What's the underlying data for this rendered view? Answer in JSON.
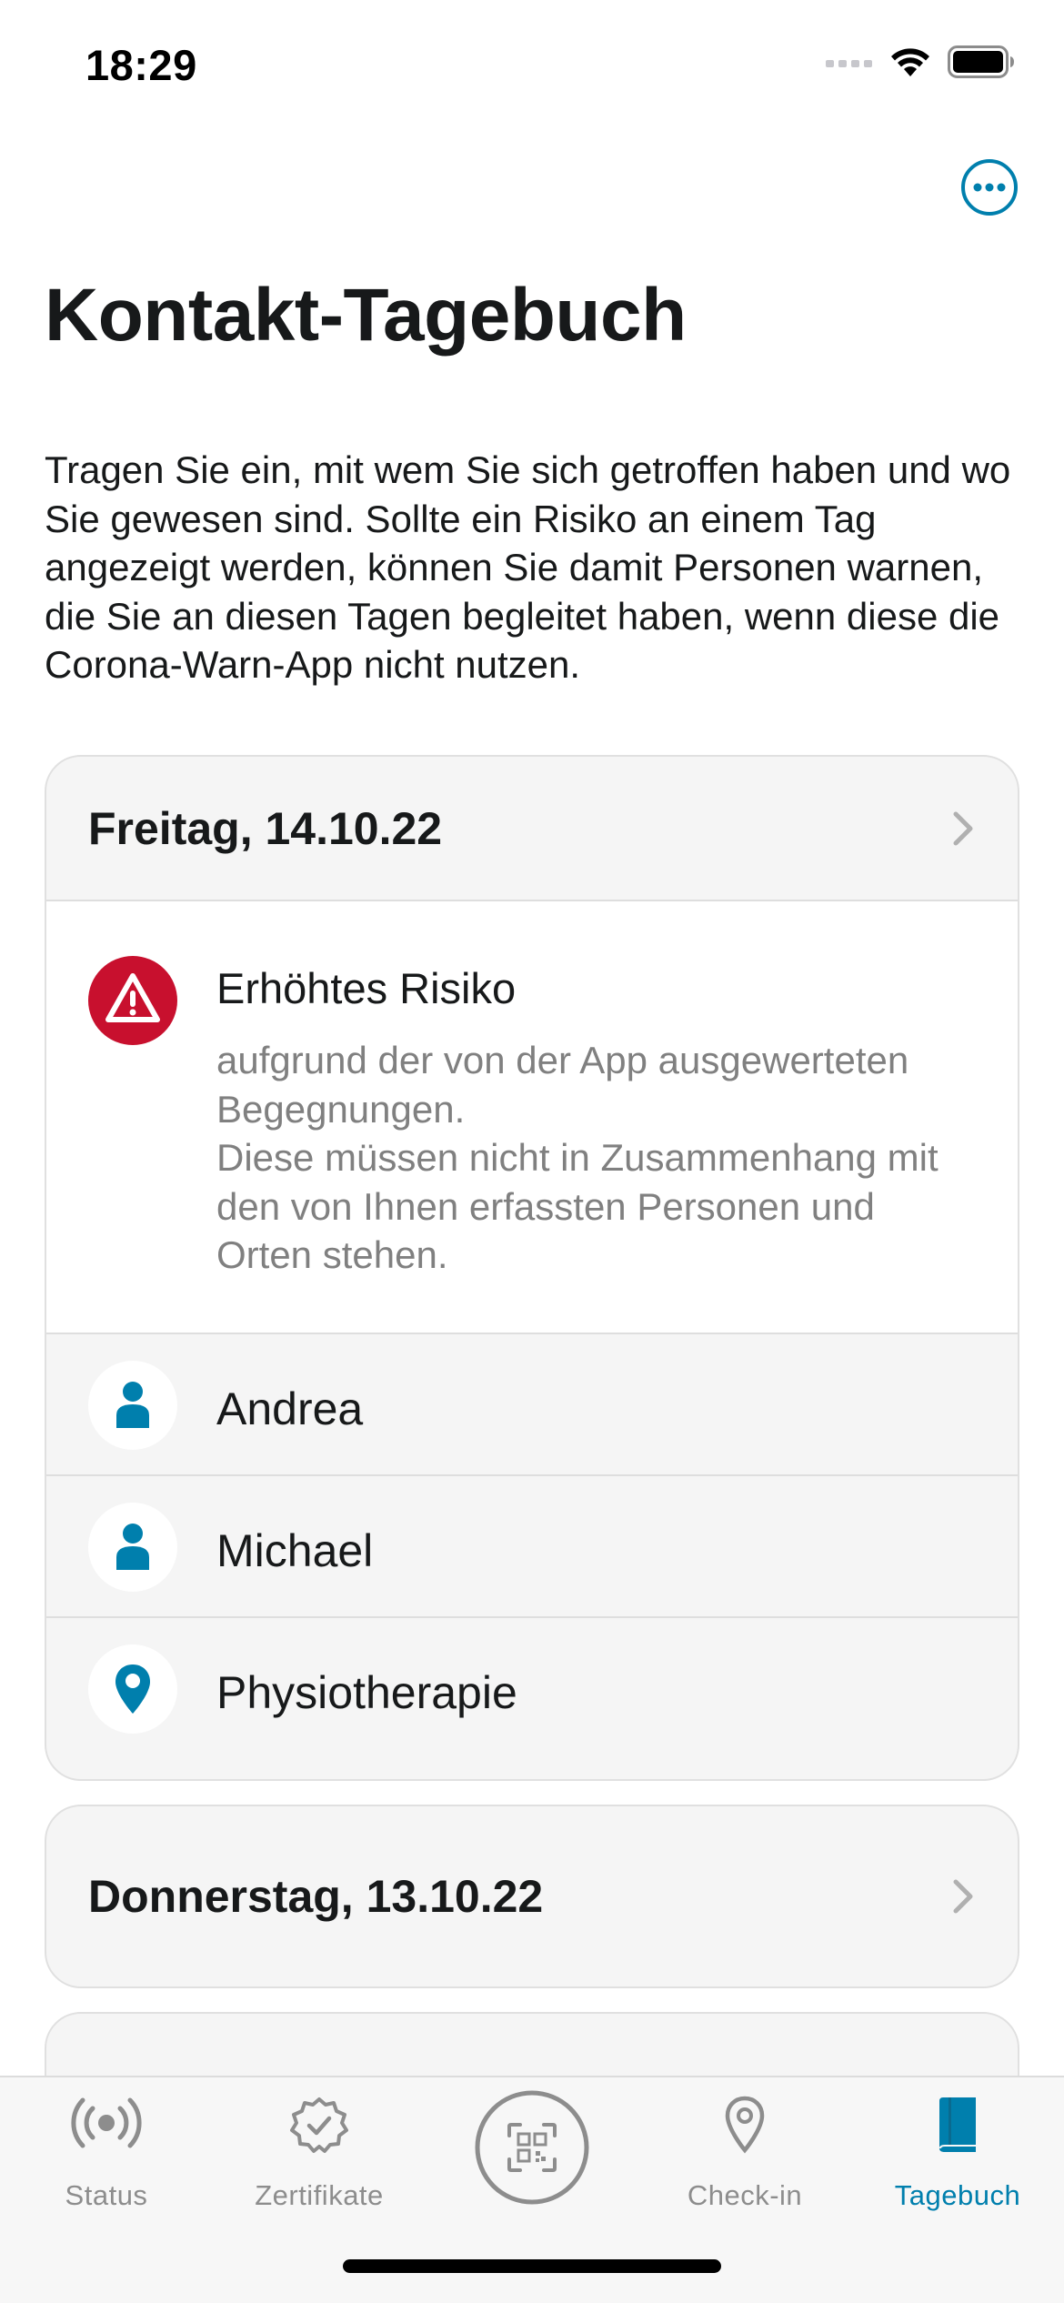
{
  "status_bar": {
    "time": "18:29"
  },
  "page": {
    "title": "Kontakt-Tagebuch",
    "intro": "Tragen Sie ein, mit wem Sie sich getroffen haben und wo Sie gewesen sind. Sollte ein Risiko an einem Tag angezeigt werden, können Sie damit Personen warnen, die Sie an diesen Tagen begleitet haben, wenn diese die Corona-Warn-App nicht nutzen."
  },
  "days": [
    {
      "date": "Freitag, 14.10.22",
      "risk": {
        "title": "Erhöhtes Risiko",
        "description": "aufgrund der von der App ausgewerteten Begegnungen.\nDiese müssen nicht in Zusammenhang mit den von Ihnen erfassten Personen und Orten stehen.",
        "icon": "warning-icon"
      },
      "entries": [
        {
          "label": "Andrea",
          "icon": "person-icon"
        },
        {
          "label": "Michael",
          "icon": "person-icon"
        },
        {
          "label": "Physiotherapie",
          "icon": "location-pin-icon"
        }
      ]
    },
    {
      "date": "Donnerstag, 13.10.22"
    }
  ],
  "tab_bar": {
    "tabs": [
      {
        "label": "Status",
        "icon": "status-icon"
      },
      {
        "label": "Zertifikate",
        "icon": "certificate-icon"
      },
      {
        "label": "Check-in",
        "icon": "location-pin-icon"
      },
      {
        "label": "Tagebuch",
        "icon": "diary-icon",
        "active": true
      }
    ],
    "scan_icon": "qr-scan-icon"
  },
  "colors": {
    "accent": "#007fad",
    "risk_red": "#c8102e",
    "card_background": "#f5f5f5",
    "tab_inactive": "#8d8d8d"
  }
}
